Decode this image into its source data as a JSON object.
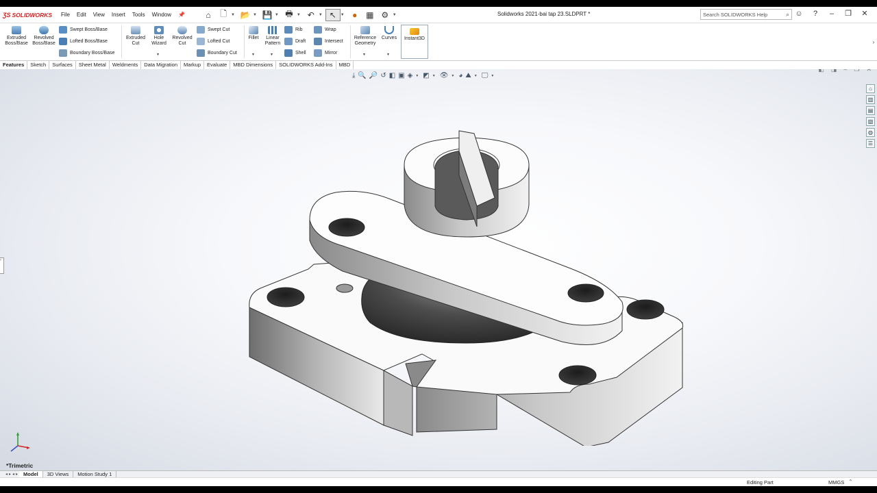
{
  "app": {
    "logo_text": "SOLIDWORKS",
    "doc_title": "Solidworks 2021-bai tap 23.SLDPRT *"
  },
  "menu": [
    "File",
    "Edit",
    "View",
    "Insert",
    "Tools",
    "Window"
  ],
  "search": {
    "placeholder": "Search SOLIDWORKS Help"
  },
  "ribbon": {
    "extruded_boss": [
      "Extruded",
      "Boss/Base"
    ],
    "revolved_boss": [
      "Revolved",
      "Boss/Base"
    ],
    "swept_boss": "Swept Boss/Base",
    "lofted_boss": "Lofted Boss/Base",
    "boundary_boss": "Boundary Boss/Base",
    "extruded_cut": [
      "Extruded",
      "Cut"
    ],
    "hole_wizard": [
      "Hole",
      "Wizard"
    ],
    "revolved_cut": [
      "Revolved",
      "Cut"
    ],
    "swept_cut": "Swept Cut",
    "lofted_cut": "Lofted Cut",
    "boundary_cut": "Boundary Cut",
    "fillet": "Fillet",
    "linear_pattern": [
      "Linear",
      "Pattern"
    ],
    "rib": "Rib",
    "draft": "Draft",
    "shell": "Shell",
    "wrap": "Wrap",
    "intersect": "Intersect",
    "mirror": "Mirror",
    "reference_geometry": [
      "Reference",
      "Geometry"
    ],
    "curves": "Curves",
    "instant3d": "Instant3D"
  },
  "tabs": [
    "Features",
    "Sketch",
    "Surfaces",
    "Sheet Metal",
    "Weldments",
    "Data Migration",
    "Markup",
    "Evaluate",
    "MBD Dimensions",
    "SOLIDWORKS Add-Ins",
    "MBD"
  ],
  "viewport": {
    "view_label": "*Trimetric"
  },
  "bottom_tabs": [
    "Model",
    "3D Views",
    "Motion Study 1"
  ],
  "status": {
    "mode": "Editing Part",
    "units": "MMGS"
  },
  "colors": {
    "accent": "#d81e1e",
    "viewport_bg": "#e8ebf1",
    "part_gray": "#bdbdbd"
  }
}
